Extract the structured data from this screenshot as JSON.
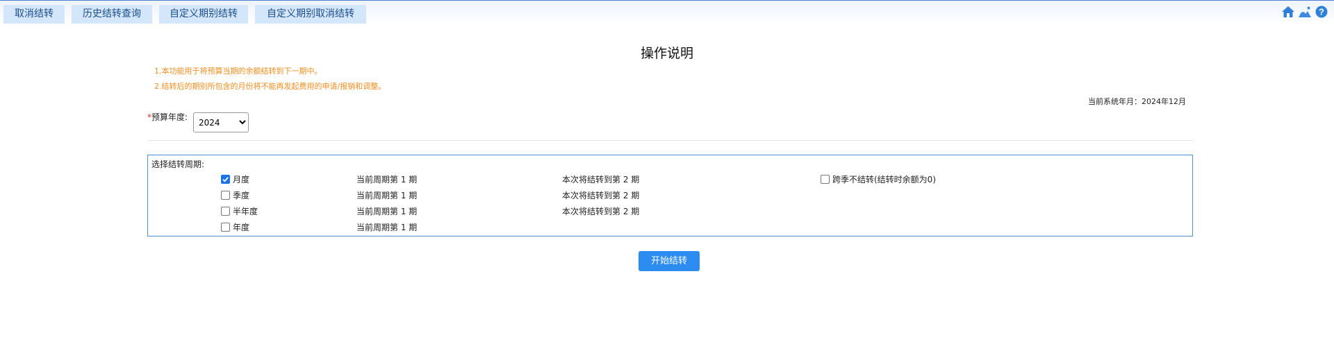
{
  "tabs": [
    "取消结转",
    "历史结转查询",
    "自定义期别结转",
    "自定义期别取消结转"
  ],
  "top_icons": [
    "home-icon",
    "mountain-icon",
    "help-icon"
  ],
  "title": "操作说明",
  "notes": [
    "1.本功能用于将预算当期的余额结转到下一期中。",
    "2.结转后的期别所包含的月份将不能再发起费用的申请/报销和调整。"
  ],
  "system_date": "当前系统年月：2024年12月",
  "budget_year": {
    "required_mark": "*",
    "label": "预算年度:",
    "value": "2024",
    "options": [
      "2024"
    ]
  },
  "period_panel": {
    "title": "选择结转周期:",
    "rows": [
      {
        "label": "月度",
        "checked": true,
        "current": "当前周期第 1 期",
        "next": "本次将结转到第 2 期"
      },
      {
        "label": "季度",
        "checked": false,
        "current": "当前周期第 1 期",
        "next": "本次将结转到第 2 期"
      },
      {
        "label": "半年度",
        "checked": false,
        "current": "当前周期第 1 期",
        "next": "本次将结转到第 2 期"
      },
      {
        "label": "年度",
        "checked": false,
        "current": "当前周期第 1 期",
        "next": ""
      }
    ],
    "cross_season": {
      "label": "跨季不结转(结转时余额为0)",
      "checked": false
    }
  },
  "start_button": "开始结转",
  "colors": {
    "accent": "#2d8cf0",
    "note": "#f08d1e",
    "tab_bg": "#d4e6f9",
    "panel_border": "#4d8fd4"
  }
}
